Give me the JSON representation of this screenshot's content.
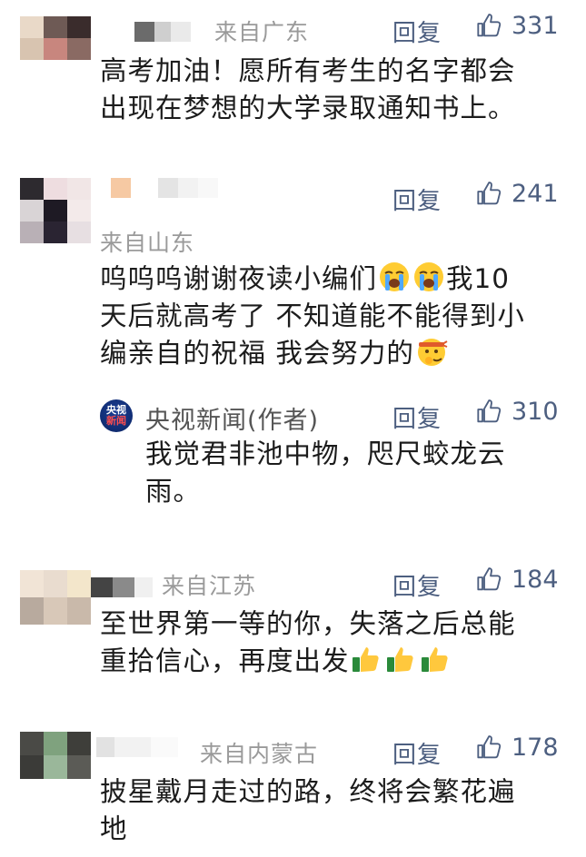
{
  "comments": [
    {
      "location": "来自广东",
      "reply": "回复",
      "likes": "331",
      "lines": [
        "高考加油！愿所有考生的名字都会",
        "出现在梦想的大学录取通知书上。"
      ]
    },
    {
      "location": "来自山东",
      "reply": "回复",
      "likes": "241",
      "lines": [
        "呜呜呜谢谢夜读小编们",
        "我10",
        "天后就高考了 不知道能不能得到小",
        "编亲自的祝福 我会努力的"
      ],
      "author_reply": {
        "logo_top": "央视",
        "logo_bottom": "新闻",
        "author": "央视新闻(作者)",
        "reply": "回复",
        "likes": "310",
        "lines": [
          "我觉君非池中物，咫尺蛟龙云",
          "雨。"
        ]
      }
    },
    {
      "location": "来自江苏",
      "reply": "回复",
      "likes": "184",
      "lines": [
        "至世界第一等的你，失落之后总能",
        "重拾信心，再度出发"
      ]
    },
    {
      "location": "来自内蒙古",
      "reply": "回复",
      "likes": "178",
      "lines": [
        "披星戴月走过的路，终将会繁花遍",
        "地"
      ]
    }
  ],
  "icons": {
    "like": "thumbs-up-outline-icon",
    "cry": "loudly-crying-face-icon",
    "determined": "headband-face-icon",
    "thumb": "thumbs-up-emoji-icon"
  },
  "colors": {
    "accent": "#4d5f80",
    "meta": "#9a9a9a",
    "text": "#1c1c1c"
  }
}
